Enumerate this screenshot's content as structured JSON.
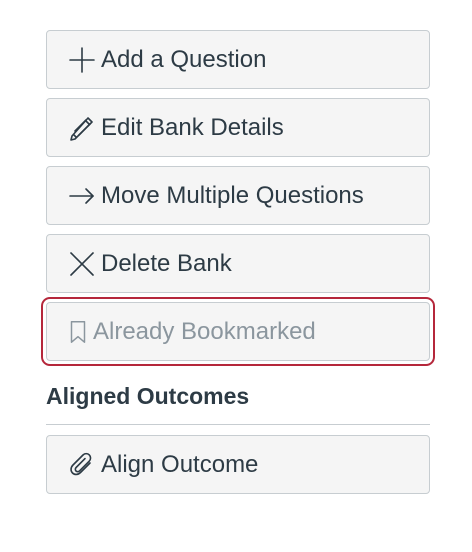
{
  "actions": {
    "add_question": "Add a Question",
    "edit_bank_details": "Edit Bank Details",
    "move_multiple_questions": "Move Multiple Questions",
    "delete_bank": "Delete Bank",
    "already_bookmarked": "Already Bookmarked"
  },
  "outcomes": {
    "heading": "Aligned Outcomes",
    "align_outcome": "Align Outcome"
  },
  "colors": {
    "text": "#2d3b45",
    "button_bg": "#f5f5f5",
    "button_border": "#c7cdd1",
    "disabled_text": "#8b969e",
    "focus_ring": "#b5273b"
  },
  "icons": {
    "add": "plus-icon",
    "edit": "pencil-icon",
    "move": "arrow-right-icon",
    "delete": "x-icon",
    "bookmark": "bookmark-icon",
    "align": "paperclip-icon"
  }
}
